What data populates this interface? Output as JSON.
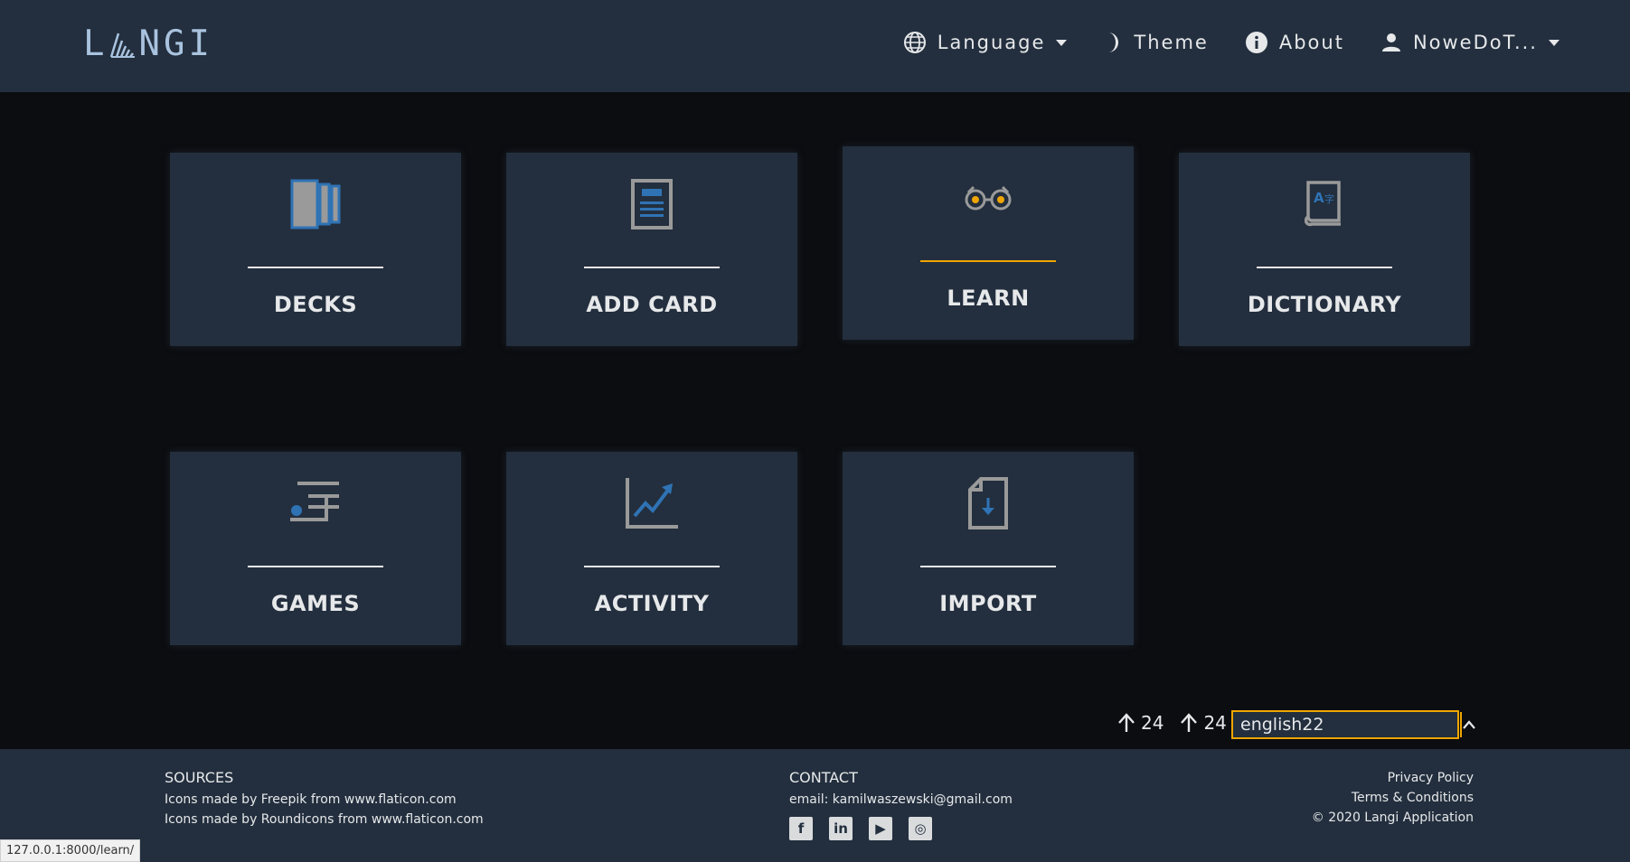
{
  "header": {
    "logo_text_left": "L",
    "logo_text_right": "NGI",
    "nav": {
      "language": "Language",
      "theme": "Theme",
      "about": "About",
      "user": "NoweDoT..."
    }
  },
  "tiles": [
    {
      "label": "DECKS",
      "icon": "decks-icon"
    },
    {
      "label": "ADD CARD",
      "icon": "add-card-icon"
    },
    {
      "label": "LEARN",
      "icon": "glasses-icon",
      "active": true
    },
    {
      "label": "DICTIONARY",
      "icon": "dictionary-icon"
    },
    {
      "label": "GAMES",
      "icon": "games-icon"
    },
    {
      "label": "ACTIVITY",
      "icon": "activity-chart-icon"
    },
    {
      "label": "IMPORT",
      "icon": "import-file-icon"
    }
  ],
  "deck_bar": {
    "upvotes_1": "24",
    "upvotes_2": "24",
    "deck_value": "english22"
  },
  "footer": {
    "sources_title": "SOURCES",
    "sources_lines": [
      "Icons made by Freepik from www.flaticon.com",
      "Icons made by Roundicons from www.flaticon.com"
    ],
    "contact_title": "CONTACT",
    "contact_email": "email: kamilwaszewski@gmail.com",
    "social": [
      "facebook-icon",
      "linkedin-icon",
      "youtube-icon",
      "instagram-icon"
    ],
    "privacy": "Privacy Policy",
    "terms": "Terms & Conditions",
    "copyright": "© 2020 Langi Application"
  },
  "status_url": "127.0.0.1:8000/learn/",
  "colors": {
    "nav_bg": "#232f3e",
    "page_bg": "#0b0d10",
    "accent": "#f0a500",
    "icon_blue": "#2f73b5",
    "icon_grey": "#9a9a9a"
  }
}
